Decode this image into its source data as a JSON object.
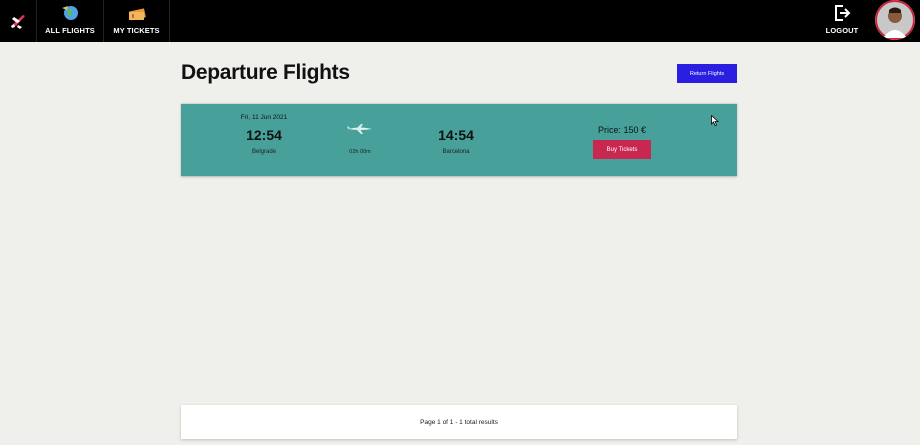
{
  "nav": {
    "all_flights": "ALL FLIGHTS",
    "my_tickets": "MY TICKETS",
    "logout": "LOGOUT"
  },
  "page": {
    "title": "Departure Flights",
    "return_button": "Return Flights"
  },
  "flight": {
    "date": "Fri, 11 Jun 2021",
    "departure_time": "12:54",
    "departure_city": "Belgrade",
    "duration": "02h 00m",
    "arrival_time": "14:54",
    "arrival_city": "Barcelona",
    "price": "Price: 150 €",
    "buy_button": "Buy Tickets"
  },
  "pagination": {
    "text": "Page 1 of 1 - 1 total results"
  },
  "colors": {
    "navbar": "#000000",
    "card": "#47a19a",
    "return_button": "#2a1fe0",
    "buy_button": "#c8284f",
    "background": "#efefec"
  },
  "icons": {
    "brand": "plane-logo-icon",
    "all_flights": "globe-icon",
    "my_tickets": "tickets-icon",
    "logout": "logout-icon",
    "flight": "airplane-icon"
  }
}
